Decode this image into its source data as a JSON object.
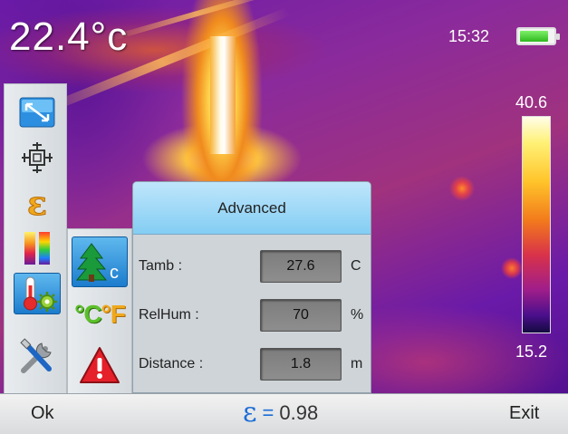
{
  "status": {
    "temperature": "22.4°c",
    "time": "15:32",
    "battery_level": 0.85
  },
  "scale": {
    "max": "40.6",
    "min": "15.2"
  },
  "tools": [
    {
      "icon": "resize-icon",
      "selected": false
    },
    {
      "icon": "crosshair-icon",
      "selected": false
    },
    {
      "icon": "emissivity-icon",
      "selected": false
    },
    {
      "icon": "palette-icon",
      "selected": false
    },
    {
      "icon": "thermometer-settings-icon",
      "selected": true
    },
    {
      "icon": "wrench-tools-icon",
      "selected": false
    }
  ],
  "sub_tools": [
    {
      "icon": "ambient-temperature-icon",
      "selected": true
    },
    {
      "icon": "celsius-fahrenheit-icon",
      "selected": false,
      "celsius": "°C",
      "fahrenheit": "°F"
    },
    {
      "icon": "warning-icon",
      "selected": false
    }
  ],
  "advanced": {
    "title": "Advanced",
    "rows": [
      {
        "label": "Tamb :",
        "value": "27.6",
        "unit": "C"
      },
      {
        "label": "RelHum :",
        "value": "70",
        "unit": "%"
      },
      {
        "label": "Distance :",
        "value": "1.8",
        "unit": "m"
      }
    ]
  },
  "bottom": {
    "ok": "Ok",
    "emissivity_symbol": "ε",
    "equals": "=",
    "emissivity_value": "0.98",
    "exit": "Exit"
  },
  "colors": {
    "highlight_blue": "#1c7ccd",
    "header_blue": "#83cdf3",
    "emissivity_blue": "#1c6dd6"
  }
}
